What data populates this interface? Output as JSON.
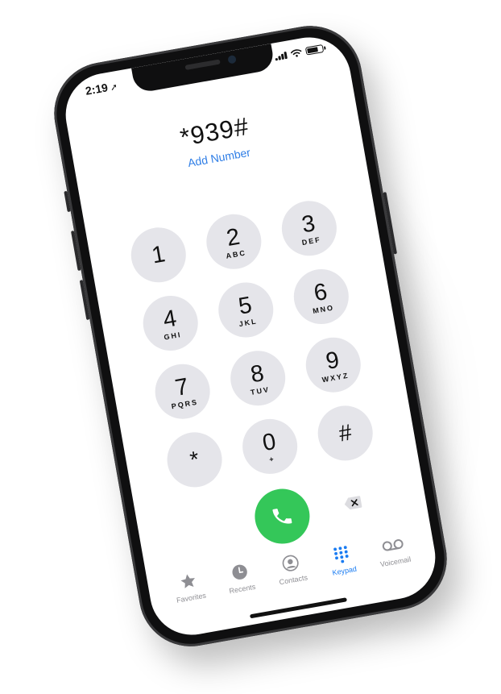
{
  "status": {
    "time": "2:19"
  },
  "dialer": {
    "number": "*939#",
    "add_number": "Add Number"
  },
  "keypad": [
    {
      "digit": "1",
      "letters": ""
    },
    {
      "digit": "2",
      "letters": "ABC"
    },
    {
      "digit": "3",
      "letters": "DEF"
    },
    {
      "digit": "4",
      "letters": "GHI"
    },
    {
      "digit": "5",
      "letters": "JKL"
    },
    {
      "digit": "6",
      "letters": "MNO"
    },
    {
      "digit": "7",
      "letters": "PQRS"
    },
    {
      "digit": "8",
      "letters": "TUV"
    },
    {
      "digit": "9",
      "letters": "WXYZ"
    },
    {
      "digit": "*",
      "letters": ""
    },
    {
      "digit": "0",
      "letters": "+"
    },
    {
      "digit": "#",
      "letters": ""
    }
  ],
  "tabs": [
    {
      "label": "Favorites",
      "icon": "star-icon",
      "active": false
    },
    {
      "label": "Recents",
      "icon": "clock-icon",
      "active": false
    },
    {
      "label": "Contacts",
      "icon": "person-circle-icon",
      "active": false
    },
    {
      "label": "Keypad",
      "icon": "keypad-grid-icon",
      "active": true
    },
    {
      "label": "Voicemail",
      "icon": "voicemail-icon",
      "active": false
    }
  ],
  "colors": {
    "accent": "#2f7ee6",
    "call_green": "#34c759",
    "key_gray": "#e5e5ea",
    "tab_inactive": "#8e8e93"
  }
}
